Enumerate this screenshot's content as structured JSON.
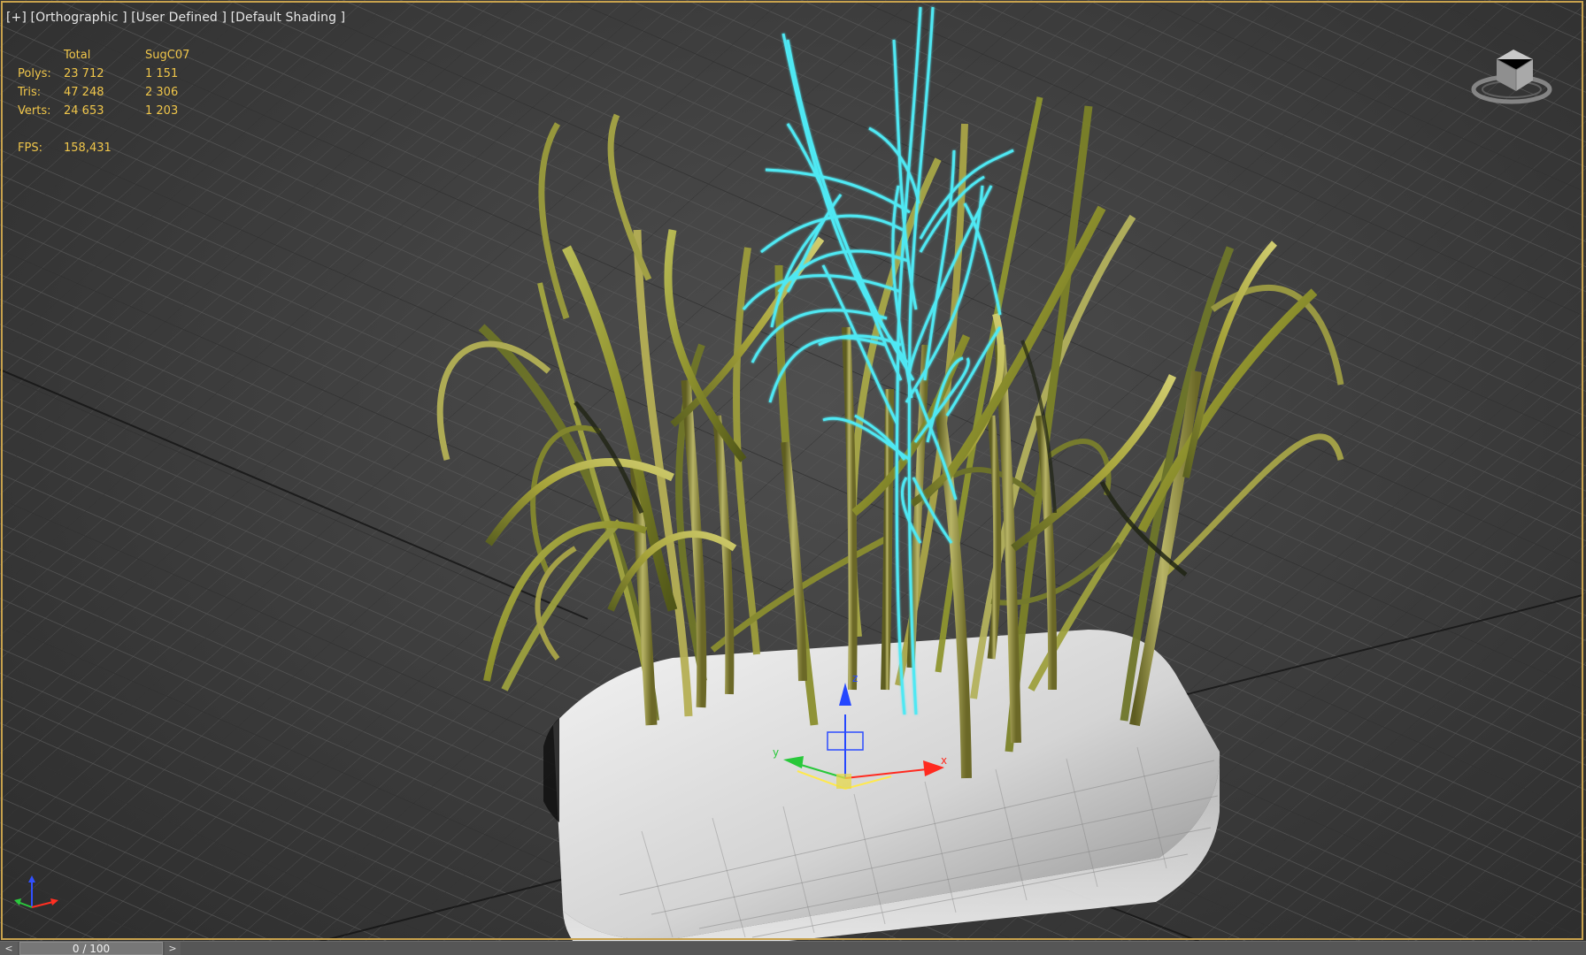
{
  "viewport": {
    "label": "[+] [Orthographic ] [User Defined ] [Default Shading ]"
  },
  "stats": {
    "headers": {
      "total": "Total",
      "selection": "SugC07"
    },
    "rows": [
      {
        "label": "Polys:",
        "total": "23 712",
        "selection": "1 151"
      },
      {
        "label": "Tris:",
        "total": "47 248",
        "selection": "2 306"
      },
      {
        "label": "Verts:",
        "total": "24 653",
        "selection": "1 203"
      }
    ],
    "fps": {
      "label": "FPS:",
      "value": "158,431"
    }
  },
  "gizmo": {
    "x_label": "x",
    "y_label": "y",
    "z_label": "z"
  },
  "timeline": {
    "prev_label": "<",
    "frame_label": "0 / 100",
    "next_label": ">"
  },
  "icons": {
    "viewcube": "viewcube-icon",
    "world_axis": "world-axis-icon",
    "transform_gizmo": "transform-gizmo-icon"
  },
  "colors": {
    "viewport_border": "#c8a24d",
    "stats_text": "#f0c64a",
    "selection_outline": "#4fe8f3",
    "plant": "#7f8626",
    "pot": "#d9d9d9",
    "axis_x": "#ff2a1f",
    "axis_y": "#28c83a",
    "axis_z": "#2547ff"
  }
}
